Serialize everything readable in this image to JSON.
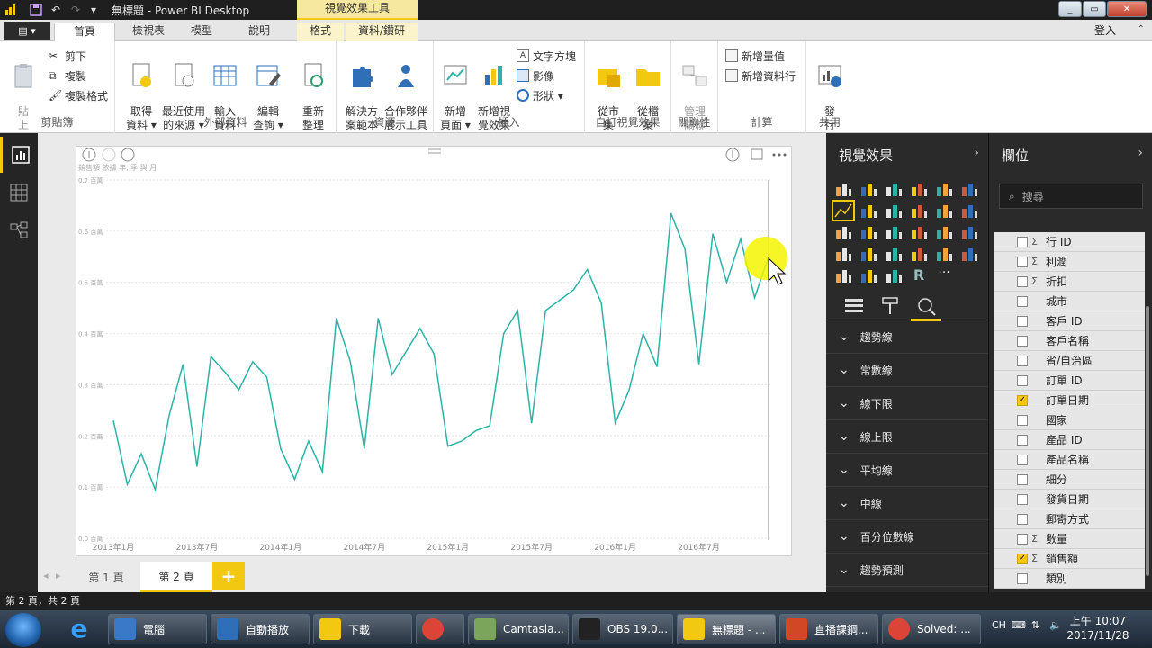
{
  "window": {
    "title": "無標題 - Power BI Desktop",
    "context_tab_header": "視覺效果工具"
  },
  "tabs": {
    "file": "▤ ▾",
    "items": [
      "首頁",
      "檢視表",
      "模型",
      "說明",
      "格式",
      "資料/鑽研"
    ],
    "active": "首頁",
    "signin": "登入"
  },
  "ribbon": {
    "clipboard": {
      "label": "剪貼簿",
      "paste": "貼\n上",
      "cut": "剪下",
      "copy": "複製",
      "format_painter": "複製格式"
    },
    "external": {
      "label": "外部資料",
      "get_data": "取得\n資料 ▾",
      "recent": "最近使用\n的來源 ▾",
      "enter": "輸入\n資料",
      "edit": "編輯\n查詢 ▾",
      "refresh": "重新\n整理"
    },
    "resources": {
      "label": "資源",
      "solution": "解決方\n案範本",
      "partner": "合作夥伴\n展示工具"
    },
    "insert": {
      "label": "插入",
      "new_page": "新增\n頁面 ▾",
      "new_visual": "新增視\n覺效果",
      "textbox": "文字方塊",
      "image": "影像",
      "shapes": "形狀 ▾"
    },
    "custom": {
      "label": "自訂視覺效果",
      "from_store": "從市\n集",
      "from_file": "從檔\n案"
    },
    "relationships": {
      "label": "關聯性",
      "manage": "管理\n關聯"
    },
    "calculations": {
      "label": "計算",
      "new_measure": "新增量值",
      "new_column": "新增資料行"
    },
    "share": {
      "label": "共用",
      "publish": "發\n行"
    }
  },
  "visual": {
    "subtitle": "銷售額 依據 年, 季 與 月"
  },
  "chart_data": {
    "type": "line",
    "title": "",
    "xlabel": "",
    "ylabel": "",
    "x_ticks": [
      "2013年1月",
      "2013年7月",
      "2014年1月",
      "2014年7月",
      "2015年1月",
      "2015年7月",
      "2016年1月",
      "2016年7月"
    ],
    "y_ticks": [
      "0.0 百萬",
      "0.1 百萬",
      "0.2 百萬",
      "0.3 百萬",
      "0.4 百萬",
      "0.5 百萬",
      "0.6 百萬",
      "0.7 百萬"
    ],
    "ylim": [
      0,
      0.7
    ],
    "unit": "百萬",
    "color": "#2ab3a6",
    "series": [
      {
        "values": [
          0.23,
          0.105,
          0.165,
          0.095,
          0.24,
          0.34,
          0.14,
          0.355,
          0.325,
          0.29,
          0.345,
          0.315,
          0.175,
          0.115,
          0.19,
          0.13,
          0.43,
          0.345,
          0.175,
          0.43,
          0.32,
          0.365,
          0.41,
          0.36,
          0.18,
          0.19,
          0.21,
          0.22,
          0.4,
          0.445,
          0.225,
          0.445,
          0.465,
          0.485,
          0.525,
          0.46,
          0.225,
          0.29,
          0.4,
          0.335,
          0.635,
          0.565,
          0.34,
          0.595,
          0.5,
          0.585,
          0.47,
          0.55
        ]
      }
    ]
  },
  "pages": {
    "tabs": [
      "第 1 頁",
      "第 2 頁"
    ],
    "active": "第 2 頁",
    "add": "+"
  },
  "status": "第 2 頁，共 2 頁",
  "viz_pane": {
    "title": "視覺效果",
    "analytics": [
      "趨勢線",
      "常數線",
      "線下限",
      "線上限",
      "平均線",
      "中線",
      "百分位數線",
      "趨勢預測"
    ]
  },
  "fields_pane": {
    "title": "欄位",
    "search_placeholder": "搜尋",
    "fields": [
      {
        "name": "行 ID",
        "sigma": true,
        "checked": false
      },
      {
        "name": "利潤",
        "sigma": true,
        "checked": false
      },
      {
        "name": "折扣",
        "sigma": true,
        "checked": false
      },
      {
        "name": "城市",
        "sigma": false,
        "checked": false
      },
      {
        "name": "客戶 ID",
        "sigma": false,
        "checked": false
      },
      {
        "name": "客戶名稱",
        "sigma": false,
        "checked": false
      },
      {
        "name": "省/自治區",
        "sigma": false,
        "checked": false
      },
      {
        "name": "訂單 ID",
        "sigma": false,
        "checked": false
      },
      {
        "name": "訂單日期",
        "sigma": false,
        "checked": true
      },
      {
        "name": "國家",
        "sigma": false,
        "checked": false
      },
      {
        "name": "產品 ID",
        "sigma": false,
        "checked": false
      },
      {
        "name": "產品名稱",
        "sigma": false,
        "checked": false
      },
      {
        "name": "細分",
        "sigma": false,
        "checked": false
      },
      {
        "name": "發貨日期",
        "sigma": false,
        "checked": false
      },
      {
        "name": "郵寄方式",
        "sigma": false,
        "checked": false
      },
      {
        "name": "數量",
        "sigma": true,
        "checked": false
      },
      {
        "name": "銷售額",
        "sigma": true,
        "checked": true
      },
      {
        "name": "類別",
        "sigma": false,
        "checked": false
      }
    ]
  },
  "taskbar": {
    "items": [
      "電腦",
      "自動播放",
      "下載",
      "",
      "Camtasia...",
      "OBS 19.0...",
      "無標題 - ...",
      "直播課鋼...",
      "Solved: ..."
    ],
    "lang": "CH",
    "time": "上午 10:07",
    "date": "2017/11/28"
  },
  "colors": {
    "accent": "#f2c811",
    "line": "#2ab3a6",
    "pane_bg": "#2a2a2a"
  }
}
